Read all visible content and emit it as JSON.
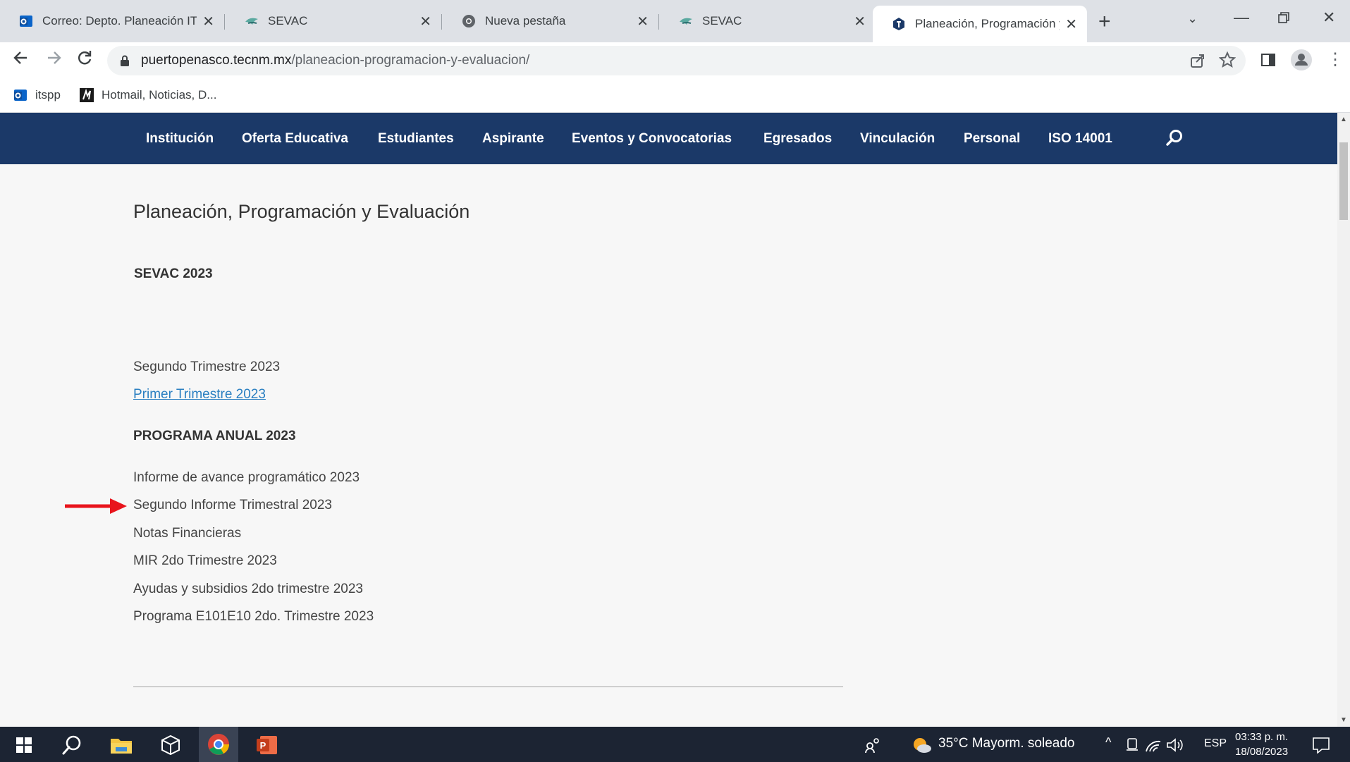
{
  "browser": {
    "tabs": [
      {
        "title": "Correo: Depto. Planeación ITSPP",
        "icon": "outlook-icon",
        "active": false
      },
      {
        "title": "SEVAC",
        "icon": "sevac-icon",
        "active": false
      },
      {
        "title": "Nueva pestaña",
        "icon": "chrome-icon",
        "active": false
      },
      {
        "title": "SEVAC",
        "icon": "sevac-icon",
        "active": false
      },
      {
        "title": "Planeación, Programación y Eva",
        "icon": "tecnm-icon",
        "active": true
      }
    ],
    "url_host": "puertopenasco.tecnm.mx",
    "url_path": "/planeacion-programacion-y-evaluacion/",
    "bookmarks": [
      {
        "label": "itspp",
        "icon": "outlook-icon"
      },
      {
        "label": "Hotmail, Noticias, D...",
        "icon": "msn-icon"
      }
    ]
  },
  "site_nav": {
    "items": [
      "Institución",
      "Oferta Educativa",
      "Estudiantes",
      "Aspirante",
      "Eventos y Convocatorias",
      "Egresados",
      "Vinculación",
      "Personal",
      "ISO 14001"
    ]
  },
  "page": {
    "title": "Planeación, Programación y Evaluación",
    "sevac_heading": "SEVAC 2023",
    "sevac_items": [
      {
        "label": "Segundo Trimestre 2023",
        "link": false
      },
      {
        "label": "Primer Trimestre 2023",
        "link": true
      }
    ],
    "programa_heading": "PROGRAMA ANUAL 2023",
    "programa_items": [
      "Informe de avance programático 2023",
      "Segundo Informe Trimestral 2023",
      "Notas Financieras",
      "MIR 2do Trimestre 2023",
      "Ayudas y subsidios 2do trimestre 2023",
      "Programa E101E10 2do. Trimestre 2023"
    ],
    "highlighted_item_index": 1,
    "arrow_color": "#e8141c"
  },
  "taskbar": {
    "weather": "35°C  Mayorm. soleado",
    "language": "ESP",
    "time": "03:33 p. m.",
    "date": "18/08/2023"
  },
  "colors": {
    "nav_bg": "#1b3968",
    "link": "#2a7fc1",
    "taskbar_bg": "#1c2433"
  }
}
